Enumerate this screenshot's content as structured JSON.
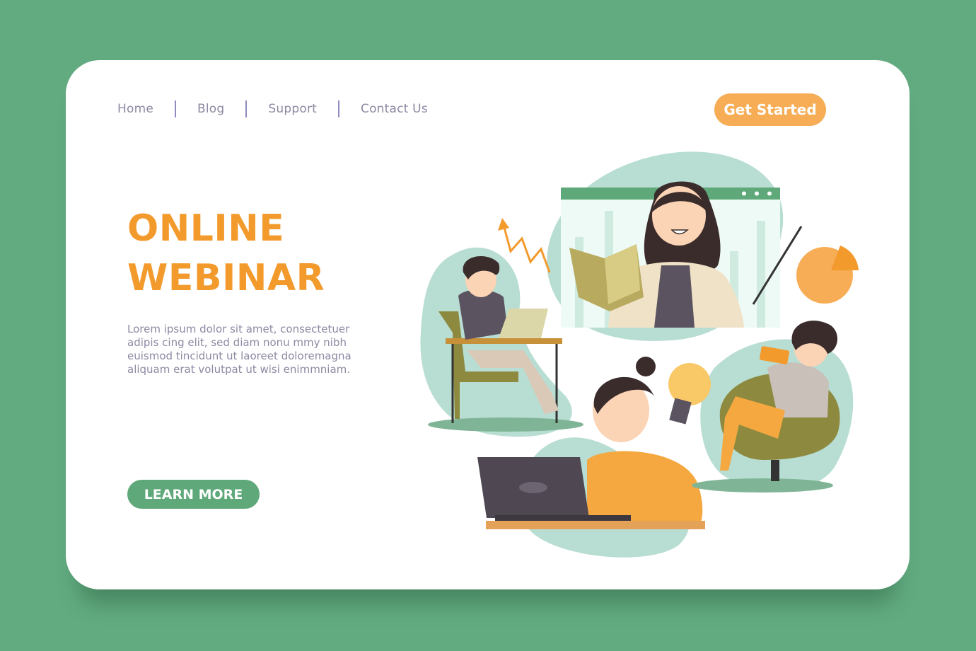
{
  "nav": {
    "items": [
      {
        "label": "Home"
      },
      {
        "label": "Blog"
      },
      {
        "label": "Support"
      },
      {
        "label": "Contact Us"
      }
    ]
  },
  "header": {
    "cta_label": "Get Started"
  },
  "hero": {
    "title_line1": "ONLINE",
    "title_line2": "WEBINAR",
    "description_lines": [
      "Lorem ipsum dolor sit amet, consectetuer",
      "adipis cing elit, sed diam nonu mmy nibh",
      "euismod tincidunt ut laoreet doloremagna",
      "aliquam erat volutpat ut wisi enimmniam."
    ],
    "button_label": "LEARN MORE"
  },
  "colors": {
    "background": "#62ab80",
    "accent_orange": "#f39a2d",
    "button_orange": "#f6ad55",
    "button_green": "#5ea879",
    "text_muted": "#8c8aa3"
  }
}
